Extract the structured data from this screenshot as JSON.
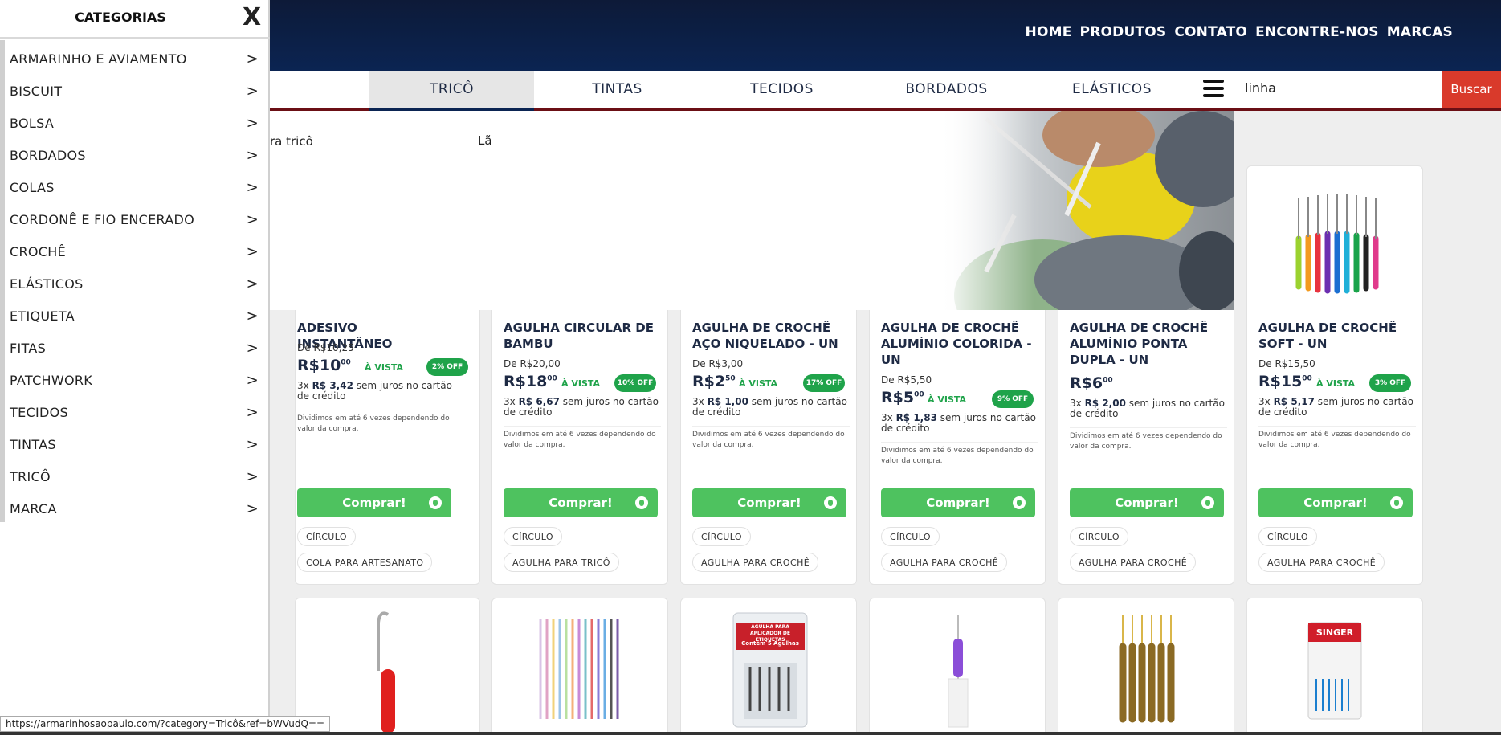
{
  "header": {
    "nav": [
      "HOME",
      "PRODUTOS",
      "CONTATO",
      "ENCONTRE-NOS",
      "MARCAS"
    ]
  },
  "category_bar": {
    "tabs": [
      "TRICÔ",
      "TINTAS",
      "TECIDOS",
      "BORDADOS",
      "ELÁSTICOS"
    ],
    "active_tab": "TRICÔ",
    "search_value": "linha",
    "search_button": "Buscar"
  },
  "banner": {
    "text_left": "ra tricô",
    "text_right": "Lã"
  },
  "products": [
    {
      "title": "ADESIVO INSTANTÂNEO",
      "from": "De R$10,25",
      "price_main": "R$10",
      "price_cents": "00",
      "avista": "À VISTA",
      "off": "2% OFF",
      "inst_prefix": "3x ",
      "inst_value": "R$ 3,42",
      "inst_suffix": " sem juros no cartão de crédito",
      "div_note": "Dividimos em até 6 vezes dependendo do valor da compra.",
      "buy": "Comprar!",
      "tags": [
        "CÍRCULO",
        "COLA PARA ARTESANATO"
      ]
    },
    {
      "title": "AGULHA CIRCULAR DE BAMBU",
      "from": "De R$20,00",
      "price_main": "R$18",
      "price_cents": "00",
      "avista": "À VISTA",
      "off": "10% OFF",
      "inst_prefix": "3x ",
      "inst_value": "R$ 6,67",
      "inst_suffix": " sem juros no cartão de crédito",
      "div_note": "Dividimos em até 6 vezes dependendo do valor da compra.",
      "buy": "Comprar!",
      "tags": [
        "CÍRCULO",
        "AGULHA PARA TRICÔ"
      ]
    },
    {
      "title": "AGULHA DE CROCHÊ AÇO NIQUELADO - UN",
      "from": "De R$3,00",
      "price_main": "R$2",
      "price_cents": "50",
      "avista": "À VISTA",
      "off": "17% OFF",
      "inst_prefix": "3x ",
      "inst_value": "R$ 1,00",
      "inst_suffix": " sem juros no cartão de crédito",
      "div_note": "Dividimos em até 6 vezes dependendo do valor da compra.",
      "buy": "Comprar!",
      "tags": [
        "CÍRCULO",
        "AGULHA PARA CROCHÊ"
      ]
    },
    {
      "title": "AGULHA DE CROCHÊ ALUMÍNIO COLORIDA - UN",
      "from": "De R$5,50",
      "price_main": "R$5",
      "price_cents": "00",
      "avista": "À VISTA",
      "off": "9% OFF",
      "inst_prefix": "3x ",
      "inst_value": "R$ 1,83",
      "inst_suffix": " sem juros no cartão de crédito",
      "div_note": "Dividimos em até 6 vezes dependendo do valor da compra.",
      "buy": "Comprar!",
      "tags": [
        "CÍRCULO",
        "AGULHA PARA CROCHÊ"
      ]
    },
    {
      "title": "AGULHA DE CROCHÊ ALUMÍNIO PONTA DUPLA - UN",
      "from": "",
      "price_main": "R$6",
      "price_cents": "00",
      "avista": "",
      "off": "",
      "inst_prefix": "3x ",
      "inst_value": "R$ 2,00",
      "inst_suffix": " sem juros no cartão de crédito",
      "div_note": "Dividimos em até 6 vezes dependendo do valor da compra.",
      "buy": "Comprar!",
      "tags": [
        "CÍRCULO",
        "AGULHA PARA CROCHÊ"
      ]
    },
    {
      "title": "AGULHA DE CROCHÊ SOFT - UN",
      "from": "De R$15,50",
      "price_main": "R$15",
      "price_cents": "00",
      "avista": "À VISTA",
      "off": "3% OFF",
      "inst_prefix": "3x ",
      "inst_value": "R$ 5,17",
      "inst_suffix": " sem juros no cartão de crédito",
      "div_note": "Dividimos em até 6 vezes dependendo do valor da compra.",
      "buy": "Comprar!",
      "tags": [
        "CÍRCULO",
        "AGULHA PARA CROCHÊ"
      ]
    }
  ],
  "second_row": {
    "label_agulha": "AGULHA PARA APLICADOR DE ETIQUETAS",
    "label_agulha_sub": "Contém 5 Agulhas",
    "label_singer": "SINGER"
  },
  "drawer": {
    "title": "CATEGORIAS",
    "close": "X",
    "arrow": ">",
    "items": [
      "ARMARINHO E AVIAMENTO",
      "BISCUIT",
      "BOLSA",
      "BORDADOS",
      "COLAS",
      "CORDONÊ E FIO ENCERADO",
      "CROCHÊ",
      "ELÁSTICOS",
      "ETIQUETA",
      "FITAS",
      "PATCHWORK",
      "TECIDOS",
      "TINTAS",
      "TRICÔ",
      "MARCA"
    ]
  },
  "status_url": "https://armarinhosaopaulo.com/?category=Tricô&ref=bWVudQ=="
}
